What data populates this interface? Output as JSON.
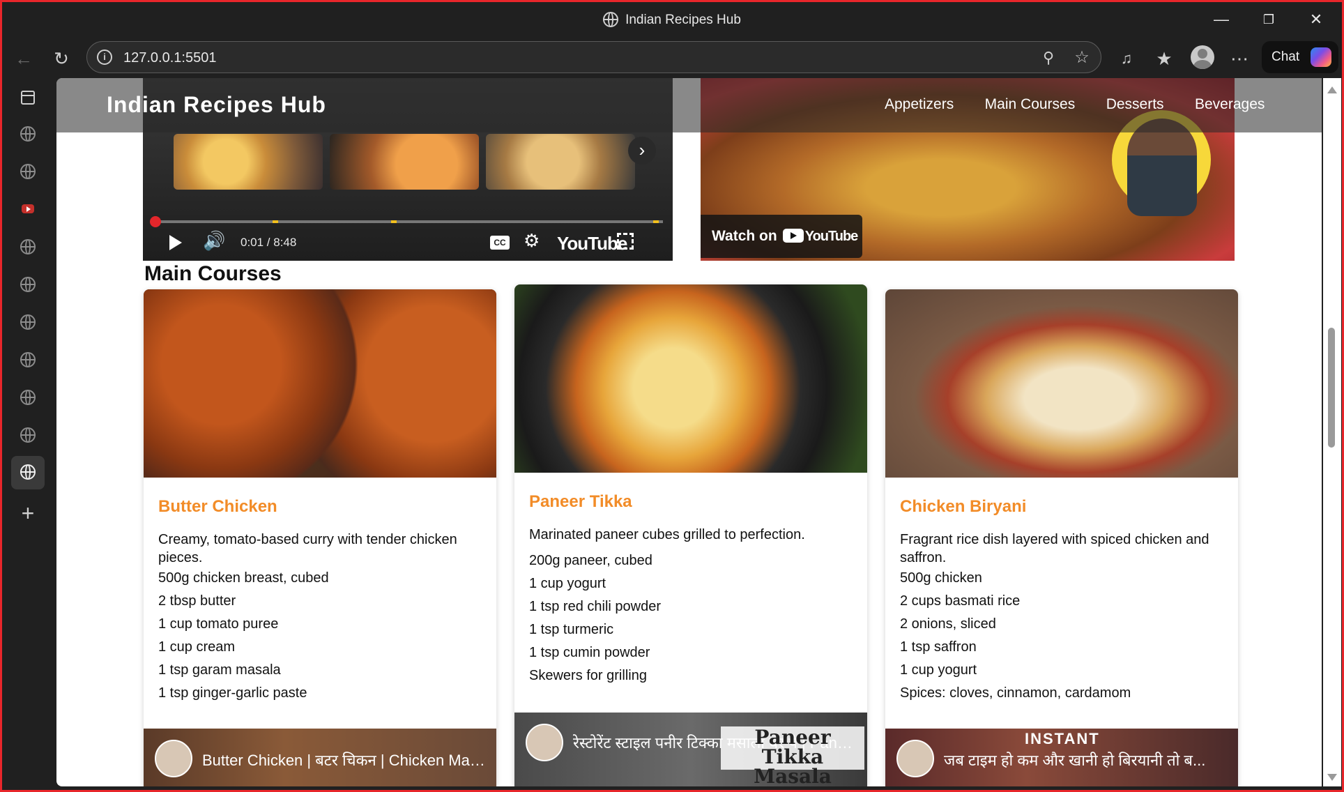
{
  "browser": {
    "window_title": "Indian Recipes Hub",
    "url": "127.0.0.1:5501",
    "chat_label": "Chat"
  },
  "site": {
    "title": "Indian Recipes Hub",
    "nav": [
      "Appetizers",
      "Main Courses",
      "Desserts",
      "Beverages"
    ]
  },
  "top_videos": {
    "player_time": "0:01 / 8:48",
    "yt_brand": "YouTube",
    "cc": "CC",
    "watch_on": "Watch on",
    "watch_brand": "YouTube"
  },
  "section": {
    "title": "Main Courses"
  },
  "cards": [
    {
      "name": "Butter Chicken",
      "description": "Creamy, tomato-based curry with tender chicken pieces.",
      "ingredients": [
        "500g chicken breast, cubed",
        "2 tbsp butter",
        "1 cup tomato puree",
        "1 cup cream",
        "1 tsp garam masala",
        "1 tsp ginger-garlic paste"
      ],
      "video_title": "Butter Chicken | बटर चिकन | Chicken Makhani"
    },
    {
      "name": "Paneer Tikka",
      "description": "Marinated paneer cubes grilled to perfection.",
      "ingredients": [
        "200g paneer, cubed",
        "1 cup yogurt",
        "1 tsp red chili powder",
        "1 tsp turmeric",
        "1 tsp cumin powder",
        "Skewers for grilling"
      ],
      "video_title": "रेस्टोरेंट स्टाइल पनीर टिक्का मसाला घर पे | Paneer Tikka Masala",
      "video_badge": "Paneer Tikka Masala"
    },
    {
      "name": "Chicken Biryani",
      "description": "Fragrant rice dish layered with spiced chicken and saffron.",
      "ingredients": [
        "500g chicken",
        "2 cups basmati rice",
        "2 onions, sliced",
        "1 tsp saffron",
        "1 cup yogurt",
        "Spices: cloves, cinnamon, cardamom"
      ],
      "video_title": "जब टाइम हो कम और खानी हो बिरयानी तो ब...",
      "video_badge": "INSTANT"
    }
  ]
}
